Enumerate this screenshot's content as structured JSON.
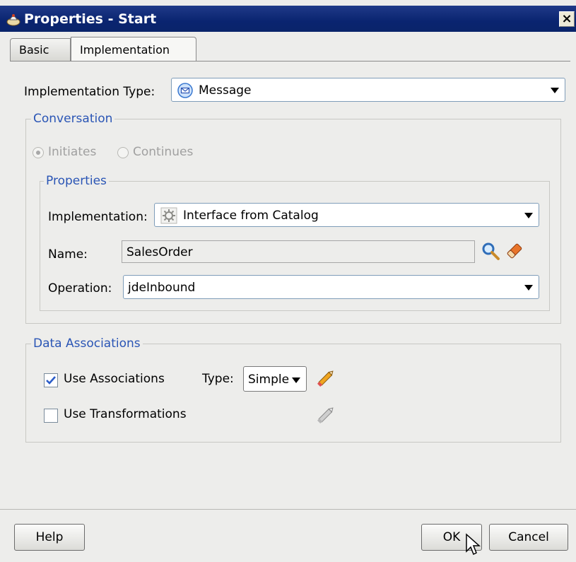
{
  "window": {
    "title": "Properties - Start",
    "close_label": "×"
  },
  "tabs": [
    {
      "label": "Basic",
      "selected": false
    },
    {
      "label": "Implementation",
      "selected": true
    }
  ],
  "implementation_type": {
    "label": "Implementation Type:",
    "value": "Message",
    "icon": "message-envelope-icon"
  },
  "conversation": {
    "title": "Conversation",
    "options": [
      {
        "label": "Initiates",
        "selected": true
      },
      {
        "label": "Continues",
        "selected": false
      }
    ]
  },
  "properties": {
    "title": "Properties",
    "implementation_label": "Implementation:",
    "implementation_value": "Interface from Catalog",
    "implementation_icon": "gear-icon",
    "name_label": "Name:",
    "name_value": "SalesOrder",
    "operation_label": "Operation:",
    "operation_value": "jdeInbound"
  },
  "data_associations": {
    "title": "Data Associations",
    "use_associations": {
      "label": "Use Associations",
      "checked": true
    },
    "type_label": "Type:",
    "type_value": "Simple",
    "use_transformations": {
      "label": "Use Transformations",
      "checked": false
    }
  },
  "buttons": {
    "help": "Help",
    "ok": "OK",
    "cancel": "Cancel"
  },
  "colors": {
    "titlebar": "#0a246a",
    "group_title": "#2a55b5",
    "background": "#ededeb"
  }
}
